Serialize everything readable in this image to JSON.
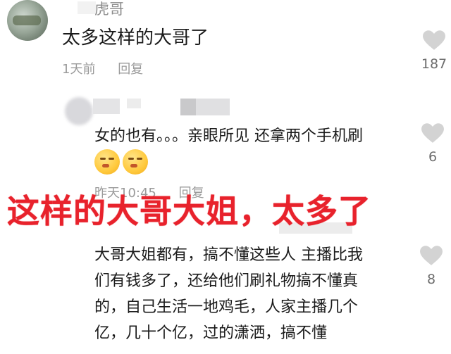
{
  "comment1": {
    "username": "虎哥",
    "text": "太多这样的大哥了",
    "time": "1天前",
    "reply_label": "回复",
    "likes": "187"
  },
  "reply1": {
    "text": "女的也有。。。亲眼所见 还拿两个手机刷",
    "emoji": "face-with-steam-emoji",
    "time": "昨天10:45",
    "reply_label": "回复",
    "likes": "6"
  },
  "overlay": {
    "headline": "这样的大哥大姐，太多了",
    "color": "#e8222c"
  },
  "reply2": {
    "text": "大哥大姐都有，搞不懂这些人 主播比我\n们有钱多了，还给他们刷礼物搞不懂真\n的，自己生活一地鸡毛，人家主播几个\n亿，几十个亿，过的潇洒，搞不懂",
    "likes": "8"
  },
  "icons": {
    "like": "heart-icon"
  }
}
